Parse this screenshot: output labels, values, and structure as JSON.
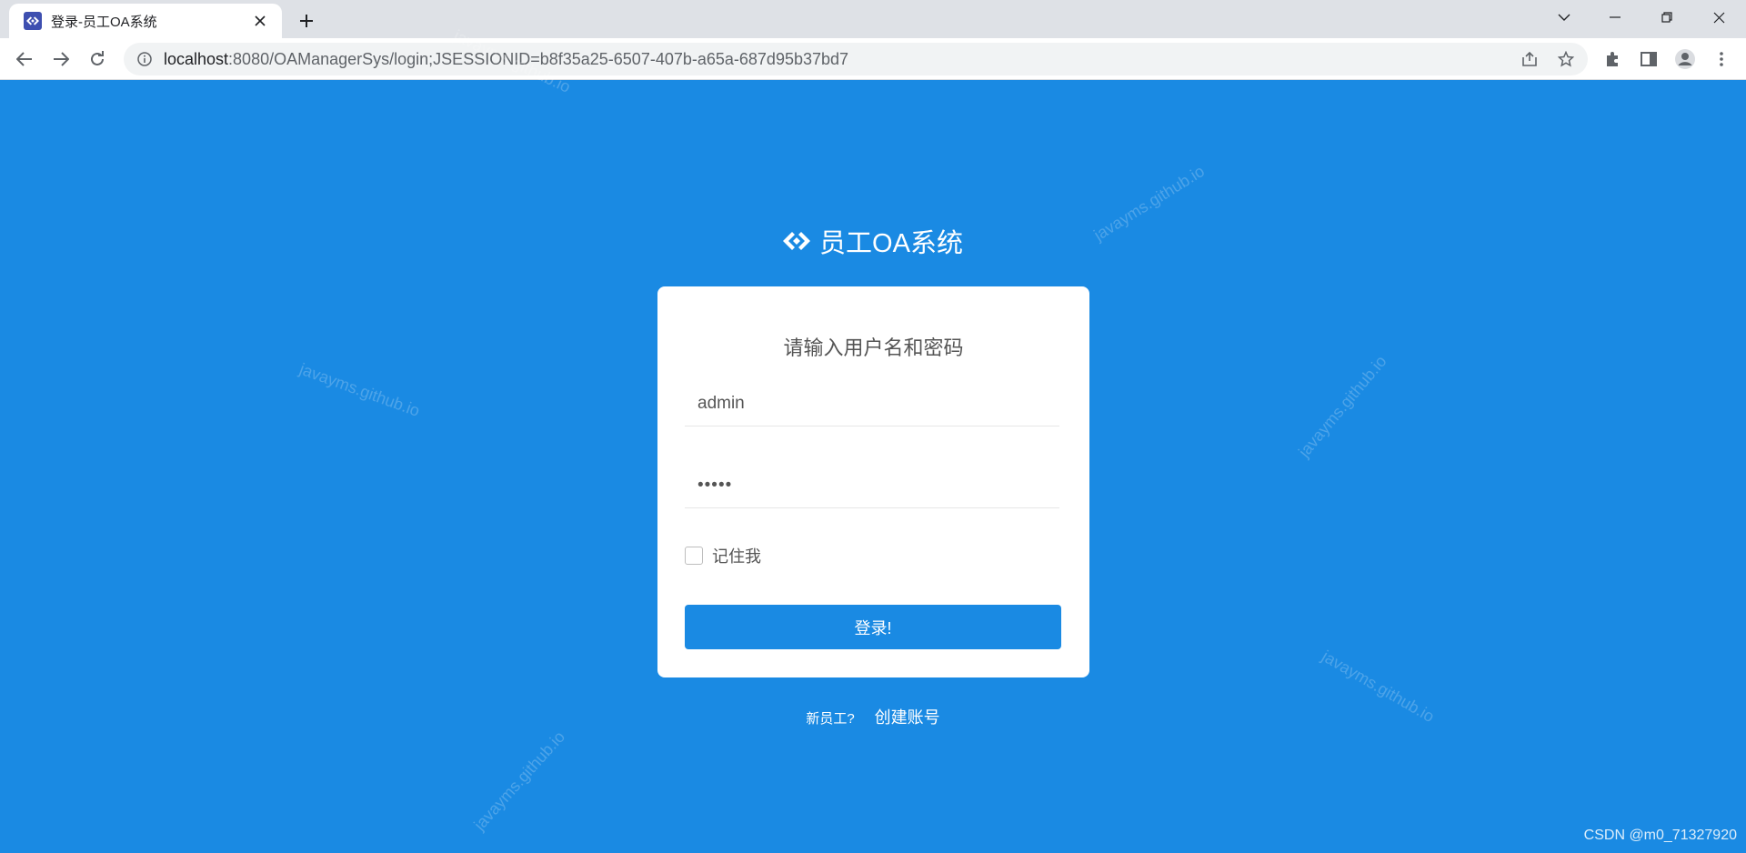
{
  "browser": {
    "tab_title": "登录-员工OA系统",
    "url_host": "localhost",
    "url_path": ":8080/OAManagerSys/login;JSESSIONID=b8f35a25-6507-407b-a65a-687d95b37bd7",
    "icons": {
      "favicon": "oa-logo-icon",
      "close": "close-icon",
      "new_tab": "plus-icon",
      "back": "arrow-left-icon",
      "forward": "arrow-right-icon",
      "reload": "reload-icon",
      "info": "info-icon",
      "share": "share-icon",
      "bookmark": "star-icon",
      "extensions": "puzzle-icon",
      "side_panel": "side-panel-icon",
      "profile": "profile-icon",
      "menu": "kebab-menu-icon"
    }
  },
  "page": {
    "brand_name": "员工OA系统",
    "login_title": "请输入用户名和密码",
    "username": {
      "value": "admin"
    },
    "password": {
      "value": "•••••"
    },
    "remember_label": "记住我",
    "remember_checked": false,
    "login_button": "登录!",
    "signup_question": "新员工?",
    "signup_link": "创建账号",
    "footer_credit": "CSDN @m0_71327920",
    "watermark_text": "javayms.github.io",
    "colors": {
      "background": "#1a8ae3",
      "button": "#1a8ae3",
      "card": "#ffffff"
    }
  }
}
